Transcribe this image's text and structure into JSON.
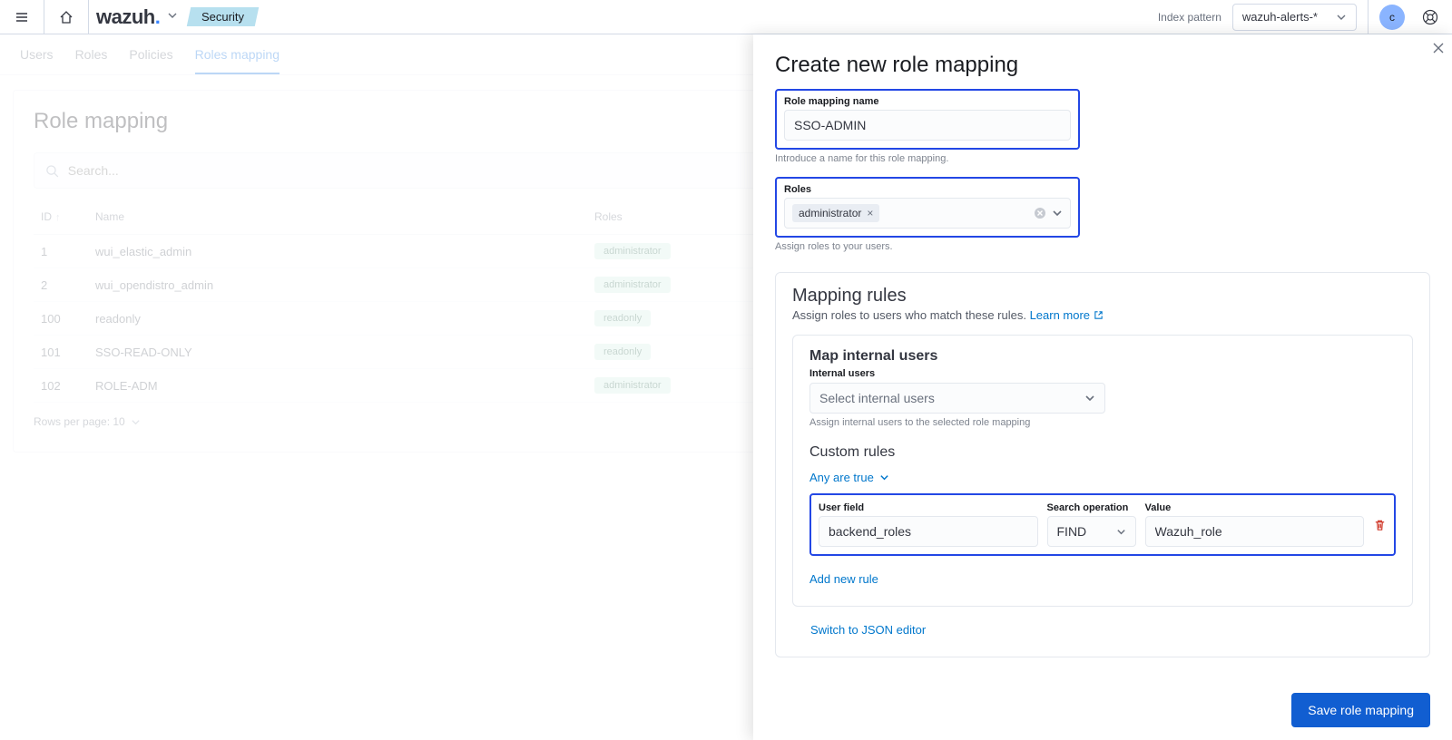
{
  "topbar": {
    "brand_main": "wazuh",
    "brand_dot": ".",
    "breadcrumb": "Security",
    "index_pattern_label": "Index pattern",
    "index_pattern_value": "wazuh-alerts-*",
    "avatar_letter": "c"
  },
  "tabs": {
    "users": "Users",
    "roles": "Roles",
    "policies": "Policies",
    "roles_mapping": "Roles mapping"
  },
  "list": {
    "title": "Role mapping",
    "search_placeholder": "Search...",
    "columns": {
      "id": "ID",
      "name": "Name",
      "roles": "Roles"
    },
    "rows": [
      {
        "id": "1",
        "name": "wui_elastic_admin",
        "role": "administrator"
      },
      {
        "id": "2",
        "name": "wui_opendistro_admin",
        "role": "administrator"
      },
      {
        "id": "100",
        "name": "readonly",
        "role": "readonly"
      },
      {
        "id": "101",
        "name": "SSO-READ-ONLY",
        "role": "readonly"
      },
      {
        "id": "102",
        "name": "ROLE-ADM",
        "role": "administrator"
      }
    ],
    "rows_per_page": "Rows per page: 10"
  },
  "flyout": {
    "title": "Create new role mapping",
    "name_label": "Role mapping name",
    "name_value": "SSO-ADMIN",
    "name_helper": "Introduce a name for this role mapping.",
    "roles_label": "Roles",
    "roles_selected": "administrator",
    "roles_helper": "Assign roles to your users.",
    "mapping_rules_title": "Mapping rules",
    "mapping_rules_sub_a": "Assign roles to users who match these rules. ",
    "learn_more": "Learn more",
    "map_internal_users_title": "Map internal users",
    "internal_users_label": "Internal users",
    "internal_users_placeholder": "Select internal users",
    "internal_users_helper": "Assign internal users to the selected role mapping",
    "custom_rules_title": "Custom rules",
    "match_mode": "Any are true",
    "rule_user_field_label": "User field",
    "rule_user_field_value": "backend_roles",
    "rule_operation_label": "Search operation",
    "rule_operation_value": "FIND",
    "rule_value_label": "Value",
    "rule_value_value": "Wazuh_role",
    "add_new_rule": "Add new rule",
    "switch_json": "Switch to JSON editor",
    "save_button": "Save role mapping"
  }
}
